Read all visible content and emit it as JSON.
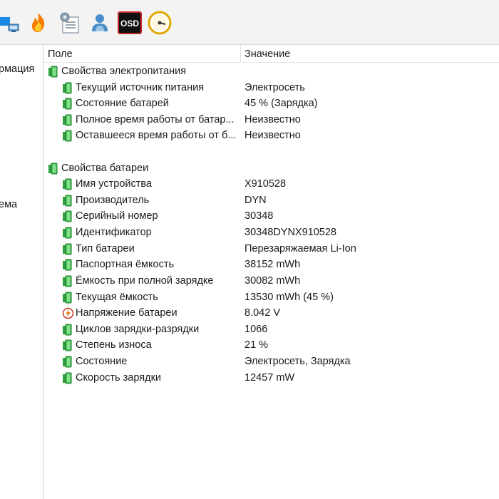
{
  "toolbar": {
    "icons": [
      "network-icon",
      "flame-icon",
      "system-settings-icon",
      "user-icon",
      "osd-icon",
      "gauge-icon"
    ],
    "osd_label": "OSD"
  },
  "left_panel": {
    "item1": "рмация",
    "item2": "ема"
  },
  "columns": {
    "field": "Поле",
    "value": "Значение"
  },
  "groups": [
    {
      "title": "Свойства электропитания",
      "rows": [
        {
          "name": "Текущий источник питания",
          "value": "Электросеть"
        },
        {
          "name": "Состояние батарей",
          "value": "45 % (Зарядка)"
        },
        {
          "name": "Полное время работы от батар...",
          "value": "Неизвестно"
        },
        {
          "name": "Оставшееся время работы от б...",
          "value": "Неизвестно"
        }
      ]
    },
    {
      "title": "Свойства батареи",
      "rows": [
        {
          "name": "Имя устройства",
          "value": "X910528"
        },
        {
          "name": "Производитель",
          "value": "DYN"
        },
        {
          "name": "Серийный номер",
          "value": "30348"
        },
        {
          "name": "Идентификатор",
          "value": "30348DYNX910528"
        },
        {
          "name": "Тип батареи",
          "value": "Перезаряжаемая Li-Ion"
        },
        {
          "name": "Паспортная ёмкость",
          "value": "38152 mWh"
        },
        {
          "name": "Ёмкость при полной зарядке",
          "value": "30082 mWh"
        },
        {
          "name": "Текущая ёмкость",
          "value": "13530 mWh  (45 %)"
        },
        {
          "name": "Напряжение батареи",
          "value": "8.042 V"
        },
        {
          "name": "Циклов зарядки-разрядки",
          "value": "1066"
        },
        {
          "name": "Степень износа",
          "value": "21 %"
        },
        {
          "name": "Состояние",
          "value": "Электросеть, Зарядка"
        },
        {
          "name": "Скорость зарядки",
          "value": "12457 mW"
        }
      ]
    }
  ]
}
